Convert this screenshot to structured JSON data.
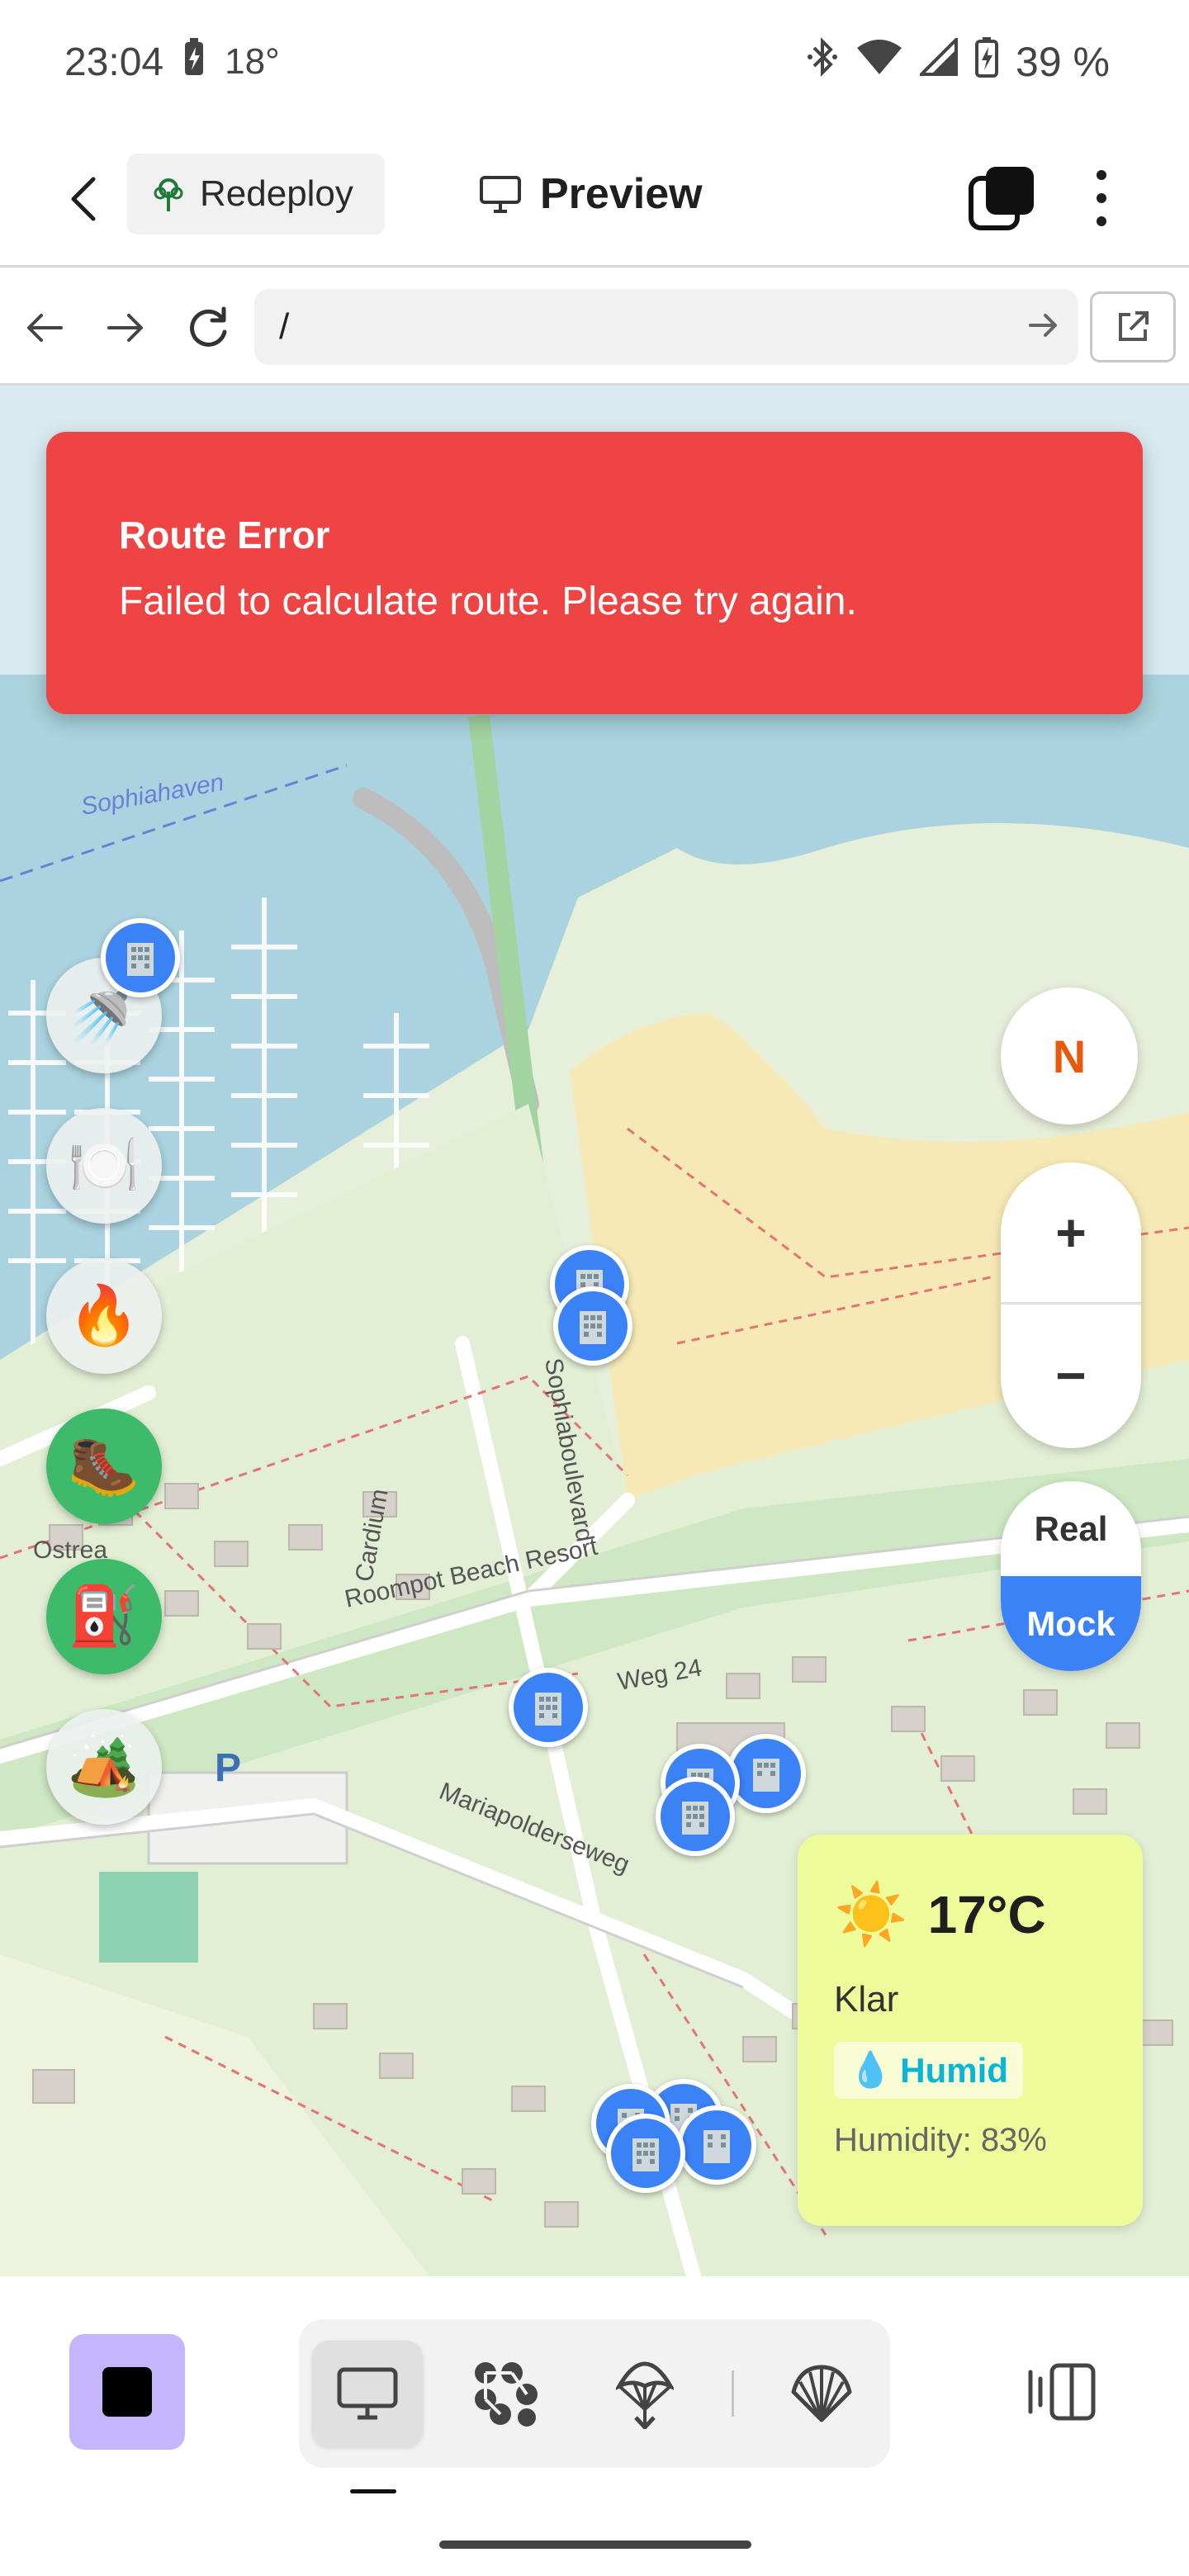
{
  "status_bar": {
    "time": "23:04",
    "temperature": "18°",
    "battery": "39 %"
  },
  "app_bar": {
    "redeploy_label": "Redeploy",
    "preview_label": "Preview"
  },
  "browser": {
    "url": "/"
  },
  "toast": {
    "title": "Route Error",
    "message": "Failed to calculate route. Please try again."
  },
  "map": {
    "compass": "N",
    "zoom_in": "+",
    "zoom_out": "−",
    "mode": {
      "real": "Real",
      "mock": "Mock",
      "selected": "Mock"
    },
    "street_labels": [
      "Sophiahaven",
      "Sophiaboulevard",
      "Ostrea",
      "Cardium",
      "Roompot Beach Resort",
      "Weg 24",
      "Mariapolderseweg",
      "P"
    ],
    "poi_buttons": [
      {
        "name": "shower",
        "icon": "🚿"
      },
      {
        "name": "restaurant",
        "icon": "🍽️"
      },
      {
        "name": "campfire",
        "icon": "🔥"
      },
      {
        "name": "hiking",
        "icon": "🥾"
      },
      {
        "name": "fuel",
        "icon": "⛽"
      },
      {
        "name": "camping",
        "icon": "🏕️"
      }
    ]
  },
  "weather": {
    "icon": "☀️",
    "temperature": "17°C",
    "condition": "Klar",
    "tag_icon": "💧",
    "tag": "Humid",
    "humidity": "Humidity: 83%"
  },
  "colors": {
    "toast": "#ef4444",
    "accent_blue": "#3b82f6",
    "stop_button": "#c4b5fd",
    "weather_card": "#eefb9a",
    "compass_n": "#e8590c"
  }
}
